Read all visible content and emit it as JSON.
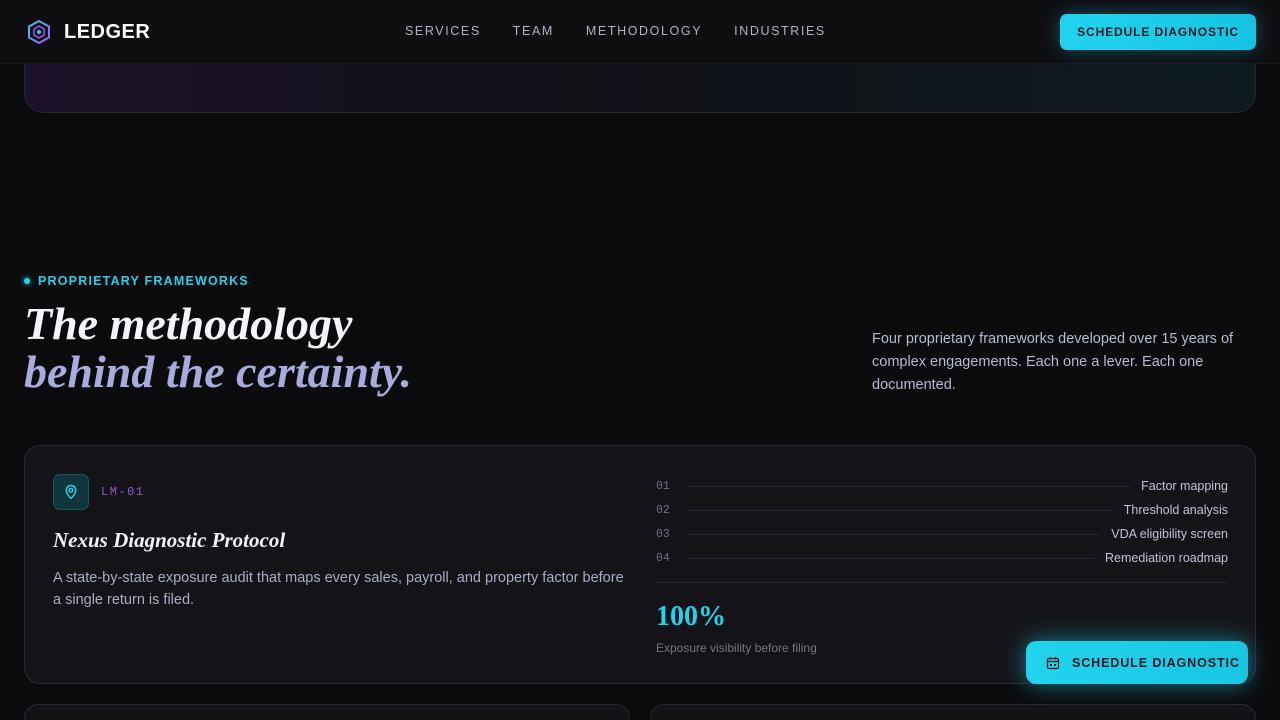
{
  "nav": {
    "brand": "LEDGER",
    "links": [
      "SERVICES",
      "TEAM",
      "METHODOLOGY",
      "INDUSTRIES"
    ],
    "cta": "SCHEDULE DIAGNOSTIC"
  },
  "section": {
    "eyebrow": "PROPRIETARY FRAMEWORKS",
    "headline_line1": "The methodology",
    "headline_line2": "behind the certainty.",
    "intro": "Four proprietary frameworks developed over 15 years of complex engagements. Each one a lever. Each one documented."
  },
  "card": {
    "icon": "location-pin-icon",
    "code": "LM-01",
    "title": "Nexus Diagnostic Protocol",
    "description": "A state-by-state exposure audit that maps every sales, payroll, and property factor before a single return is filed.",
    "steps": [
      {
        "num": "01",
        "label": "Factor mapping"
      },
      {
        "num": "02",
        "label": "Threshold analysis"
      },
      {
        "num": "03",
        "label": "VDA eligibility screen"
      },
      {
        "num": "04",
        "label": "Remediation roadmap"
      }
    ],
    "stat_value": "100%",
    "stat_label": "Exposure visibility before filing"
  },
  "floating_cta": {
    "icon": "calendar-icon",
    "label": "SCHEDULE DIAGNOSTIC"
  },
  "colors": {
    "accent": "#22d3ee",
    "code_purple": "#9b55d8",
    "background": "#0b0b0d"
  }
}
